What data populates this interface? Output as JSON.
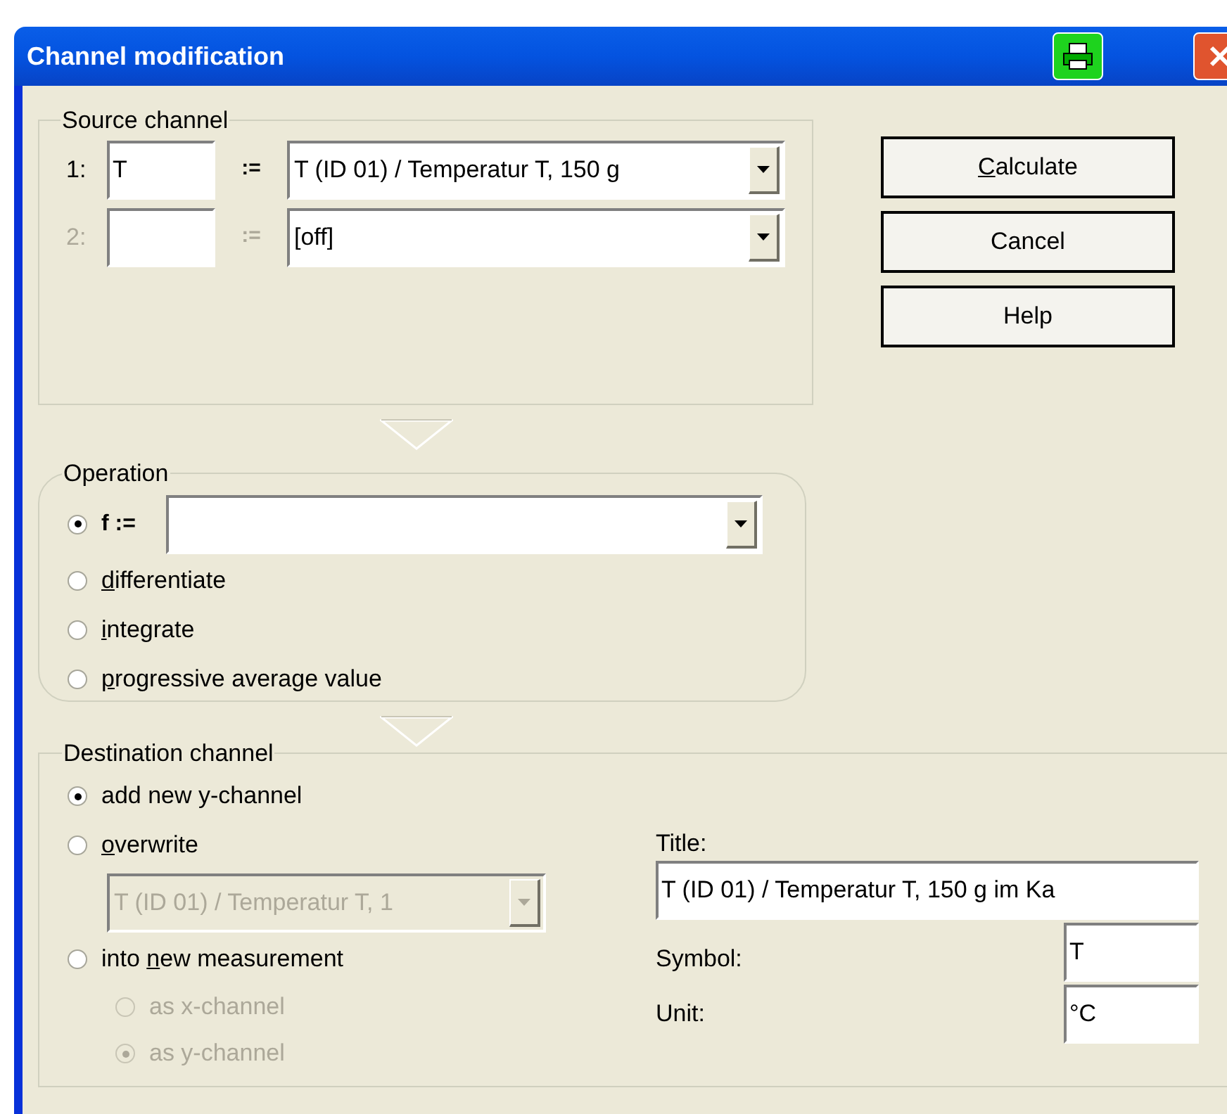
{
  "window": {
    "title": "Channel modification"
  },
  "source_channel": {
    "title": "Source channel",
    "rows": [
      {
        "index": "1:",
        "symbol": "T",
        "assign": ":=",
        "channel": "T (ID 01) / Temperatur T, 150 g",
        "disabled": false
      },
      {
        "index": "2:",
        "assign": ":=",
        "channel": "[off]",
        "disabled": true
      }
    ]
  },
  "buttons": [
    {
      "key": "C",
      "after": "alculate"
    },
    {
      "after": "Cancel"
    },
    {
      "after": "Help"
    }
  ],
  "operation": {
    "title": "Operation",
    "options": [
      {
        "kind": "formula",
        "label": "f :=",
        "selected": true
      },
      {
        "kind": "plain",
        "key": "d",
        "after": "ifferentiate",
        "selected": false
      },
      {
        "kind": "plain",
        "key": "i",
        "after": "ntegrate",
        "selected": false
      },
      {
        "kind": "plain",
        "key": "p",
        "after": "rogressive average value",
        "selected": false
      }
    ]
  },
  "destination": {
    "title": "Destination channel",
    "options": [
      {
        "after": "add new y-channel",
        "selected": true,
        "disabled": false
      },
      {
        "key": "o",
        "after": "verwrite",
        "selected": false,
        "disabled": false
      },
      {
        "before": "into ",
        "key": "n",
        "after": "ew measurement",
        "selected": false,
        "disabled": false
      }
    ],
    "overwrite_channel": {
      "value": "T (ID 01) / Temperatur T, 1",
      "disabled": true
    },
    "sub_options": [
      {
        "label": "as x-channel",
        "selected": false,
        "disabled": true
      },
      {
        "label": "as y-channel",
        "selected": true,
        "disabled": true
      }
    ],
    "title_label": "Title:",
    "title_value": "T (ID 01) / Temperatur T, 150 g im Ka",
    "symbol_label": "Symbol:",
    "symbol_value": "T",
    "unit_label": "Unit:",
    "unit_value": "°C"
  }
}
